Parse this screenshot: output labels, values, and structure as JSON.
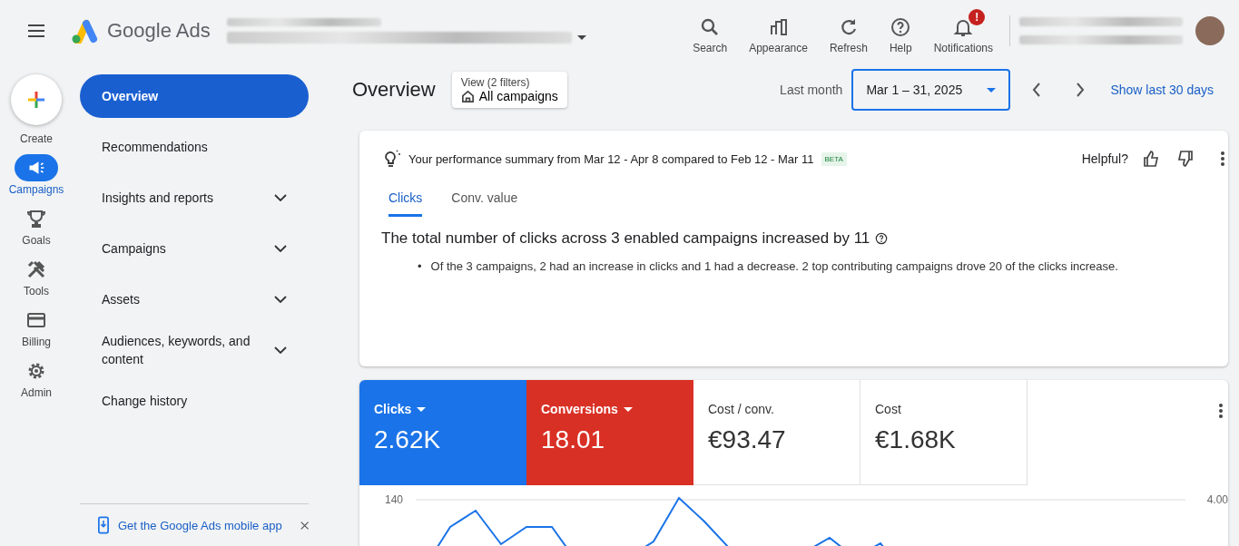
{
  "header": {
    "product": "Google Ads",
    "notification_badge": "!",
    "actions": [
      {
        "label": "Search",
        "kind": "search"
      },
      {
        "label": "Appearance",
        "kind": "appearance"
      },
      {
        "label": "Refresh",
        "kind": "refresh"
      },
      {
        "label": "Help",
        "kind": "help"
      },
      {
        "label": "Notifications",
        "kind": "notifications"
      }
    ]
  },
  "rail": [
    {
      "label": "Create",
      "kind": "create",
      "selected": false
    },
    {
      "label": "Campaigns",
      "kind": "campaigns",
      "selected": true
    },
    {
      "label": "Goals",
      "kind": "goals",
      "selected": false
    },
    {
      "label": "Tools",
      "kind": "tools",
      "selected": false
    },
    {
      "label": "Billing",
      "kind": "billing",
      "selected": false
    },
    {
      "label": "Admin",
      "kind": "admin",
      "selected": false
    }
  ],
  "nav": [
    {
      "label": "Overview",
      "selected": true,
      "expandable": false
    },
    {
      "label": "Recommendations",
      "selected": false,
      "expandable": false
    },
    {
      "label": "Insights and reports",
      "selected": false,
      "expandable": true
    },
    {
      "label": "Campaigns",
      "selected": false,
      "expandable": true
    },
    {
      "label": "Assets",
      "selected": false,
      "expandable": true
    },
    {
      "label": "Audiences, keywords, and content",
      "selected": false,
      "expandable": true
    },
    {
      "label": "Change history",
      "selected": false,
      "expandable": false
    }
  ],
  "mobile_promo": "Get the Google Ads mobile app",
  "page": {
    "title": "Overview",
    "view_label": "View (2 filters)",
    "view_value": "All campaigns",
    "range_label": "Last month",
    "date_range": "Mar 1 – 31, 2025",
    "show_last": "Show last 30 days"
  },
  "summary": {
    "title": "Your performance summary from Mar 12 - Apr 8 compared to Feb 12 - Mar 11",
    "badge": "BETA",
    "helpful": "Helpful?",
    "tabs": [
      {
        "label": "Clicks",
        "selected": true
      },
      {
        "label": "Conv. value",
        "selected": false
      }
    ],
    "headline": "The total number of clicks across 3 enabled campaigns increased by 11",
    "bullet_marker": "•",
    "bullets": [
      "Of the 3 campaigns, 2 had an increase in clicks and 1 had a decrease. 2 top contributing campaigns drove 20 of the clicks increase."
    ]
  },
  "metrics": [
    {
      "label": "Clicks",
      "value": "2.62K",
      "dropdown": true,
      "color": "#1a73e8"
    },
    {
      "label": "Conversions",
      "value": "18.01",
      "dropdown": true,
      "color": "#d93025"
    },
    {
      "label": "Cost / conv.",
      "value": "€93.47",
      "dropdown": false
    },
    {
      "label": "Cost",
      "value": "€1.68K",
      "dropdown": false
    }
  ],
  "chart": {
    "left_tick": "140",
    "right_tick": "4.00"
  }
}
